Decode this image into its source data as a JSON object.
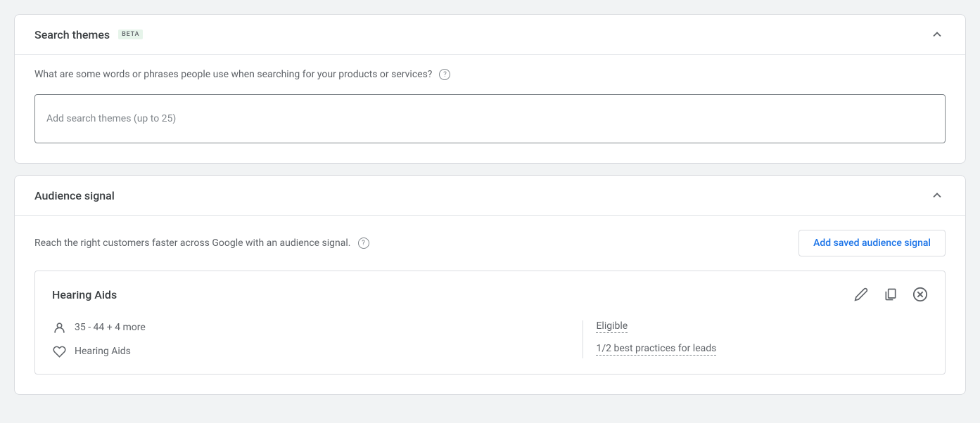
{
  "search_themes": {
    "title": "Search themes",
    "badge": "BETA",
    "description": "What are some words or phrases people use when searching for your products or services?",
    "input_placeholder": "Add search themes (up to 25)"
  },
  "audience_signal": {
    "title": "Audience signal",
    "description": "Reach the right customers faster across Google with an audience signal.",
    "add_button": "Add saved audience signal",
    "audience": {
      "name": "Hearing Aids",
      "demographics": "35 - 44 + 4 more",
      "interest": "Hearing Aids",
      "status": "Eligible",
      "practices": "1/2 best practices for leads"
    }
  }
}
